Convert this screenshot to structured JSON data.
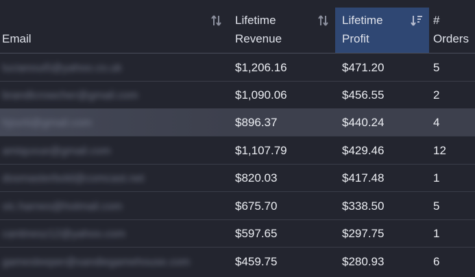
{
  "table": {
    "columns": {
      "email": "Email",
      "revenue_line1": "Lifetime",
      "revenue_line2": "Revenue",
      "profit_line1": "Lifetime",
      "profit_line2": "Profit",
      "orders_line1": "#",
      "orders_line2": "Orders"
    },
    "sorted_column": "Lifetime Profit",
    "sort_direction": "descending",
    "rows": [
      {
        "email": "lucianoui5@yahoo.co.uk",
        "revenue": "$1,206.16",
        "profit": "$471.20",
        "orders": "5"
      },
      {
        "email": "brandlcrowcher@gmail.com",
        "revenue": "$1,090.06",
        "profit": "$456.55",
        "orders": "2"
      },
      {
        "email": "hjsvrti@gmail.com",
        "revenue": "$896.37",
        "profit": "$440.24",
        "orders": "4"
      },
      {
        "email": "amiquvue@gmail.com",
        "revenue": "$1,107.79",
        "profit": "$429.46",
        "orders": "12"
      },
      {
        "email": "dosmasterbold@comcast.net",
        "revenue": "$820.03",
        "profit": "$417.48",
        "orders": "1"
      },
      {
        "email": "vic.harnes@hotmail.com",
        "revenue": "$675.70",
        "profit": "$338.50",
        "orders": "5"
      },
      {
        "email": "cantinesz12@yahoo.com",
        "revenue": "$597.65",
        "profit": "$297.75",
        "orders": "1"
      },
      {
        "email": "gamesleeper@sandiegamehouse.com",
        "revenue": "$459.75",
        "profit": "$280.93",
        "orders": "6"
      }
    ]
  },
  "colors": {
    "background": "#23252f",
    "sorted_header": "#2f4773",
    "hover_row": "#3d404d"
  },
  "icons": {
    "unsorted": "sort-arrows-icon",
    "sorted": "sort-descending-icon"
  }
}
